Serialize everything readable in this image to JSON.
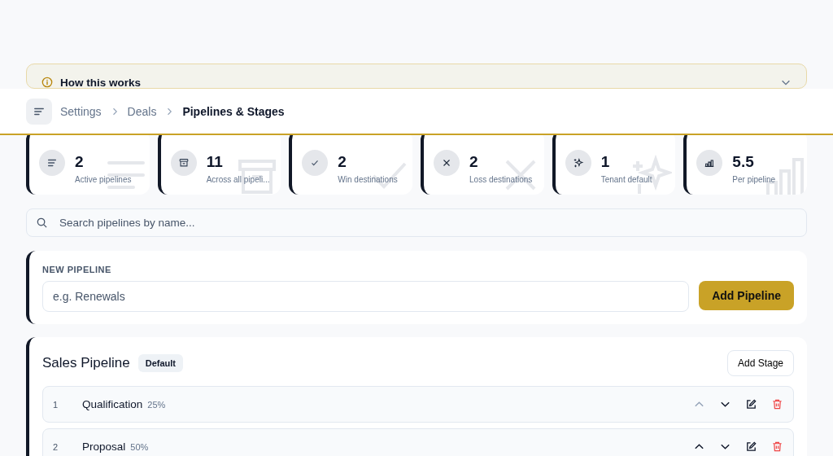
{
  "info_panel": {
    "title": "How this works",
    "expanded": false
  },
  "header": {
    "breadcrumbs": [
      {
        "label": "Settings",
        "current": false
      },
      {
        "label": "Deals",
        "current": false
      },
      {
        "label": "Pipelines & Stages",
        "current": true
      }
    ]
  },
  "stats": [
    {
      "kind": "lines",
      "value": "2",
      "label": "Active pipelines"
    },
    {
      "kind": "archive",
      "value": "11",
      "label": "Across all pipeli..."
    },
    {
      "kind": "check",
      "value": "2",
      "label": "Win destinations"
    },
    {
      "kind": "cross",
      "value": "2",
      "label": "Loss destinations"
    },
    {
      "kind": "sparkles",
      "value": "1",
      "label": "Tenant default"
    },
    {
      "kind": "chart",
      "value": "5.5",
      "label": "Per pipeline"
    }
  ],
  "search": {
    "placeholder": "Search pipelines by name..."
  },
  "new_pipeline": {
    "label": "NEW PIPELINE",
    "placeholder": "e.g. Renewals",
    "button": "Add Pipeline"
  },
  "pipelines": [
    {
      "name": "Sales Pipeline",
      "badge": "Default",
      "add_button": "Add Stage",
      "stages": [
        {
          "number": "1",
          "name": "Qualification",
          "probability": "25%",
          "up_disabled": true,
          "down_disabled": false
        },
        {
          "number": "2",
          "name": "Proposal",
          "probability": "50%",
          "up_disabled": false,
          "down_disabled": false
        }
      ]
    }
  ]
}
